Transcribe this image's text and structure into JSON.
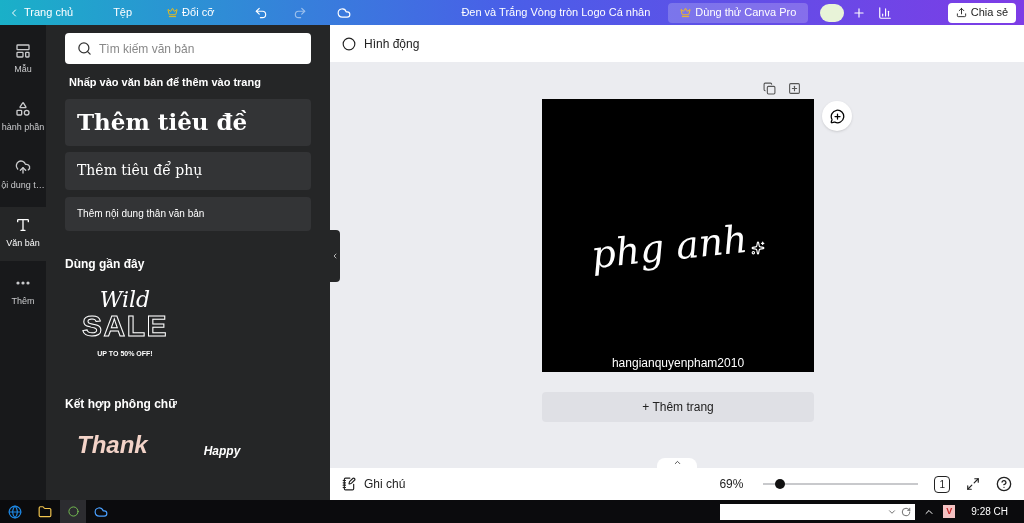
{
  "topbar": {
    "home": "Trang chủ",
    "file": "Tệp",
    "resize": "Đổi cỡ",
    "title": "Đen và Trắng Vòng tròn Logo Cá nhân",
    "pro": "Dùng thử Canva Pro",
    "share": "Chia sẻ"
  },
  "rail": [
    {
      "kind": "template",
      "label": "Mẫu",
      "selected": false
    },
    {
      "kind": "elements",
      "label": "hành phần",
      "selected": false
    },
    {
      "kind": "upload",
      "label": "ội dung t…",
      "selected": false
    },
    {
      "kind": "text",
      "label": "Văn bản",
      "selected": true
    },
    {
      "kind": "more",
      "label": "Thêm",
      "selected": false
    }
  ],
  "panel": {
    "search": {
      "placeholder": "Tìm kiếm văn bản"
    },
    "hint": "Nhấp vào văn bản để thêm vào trang",
    "presets": [
      {
        "kind": "heading",
        "label": "Thêm tiêu đề"
      },
      {
        "kind": "subheading",
        "label": "Thêm tiêu để phụ"
      },
      {
        "kind": "body",
        "label": "Thêm nội dung thân văn bản"
      }
    ],
    "recent_title": "Dùng gần đây",
    "recent": {
      "line1": "Wild",
      "line2": "SALE",
      "line3": "UP TO 50% OFF!"
    },
    "combos_title": "Kết hợp phông chữ",
    "combos": [
      "Thank",
      "Happy"
    ]
  },
  "canvas": {
    "animate": "Hình động",
    "design": {
      "script": "phg anh",
      "credit": "hangianquyenpham2010"
    },
    "add_page": "+ Thêm trang"
  },
  "bottombar": {
    "notes": "Ghi chú",
    "zoom": "69%",
    "level": 0.11,
    "page": "1"
  },
  "taskbar": {
    "time": "9:28 CH",
    "tray": "V"
  }
}
